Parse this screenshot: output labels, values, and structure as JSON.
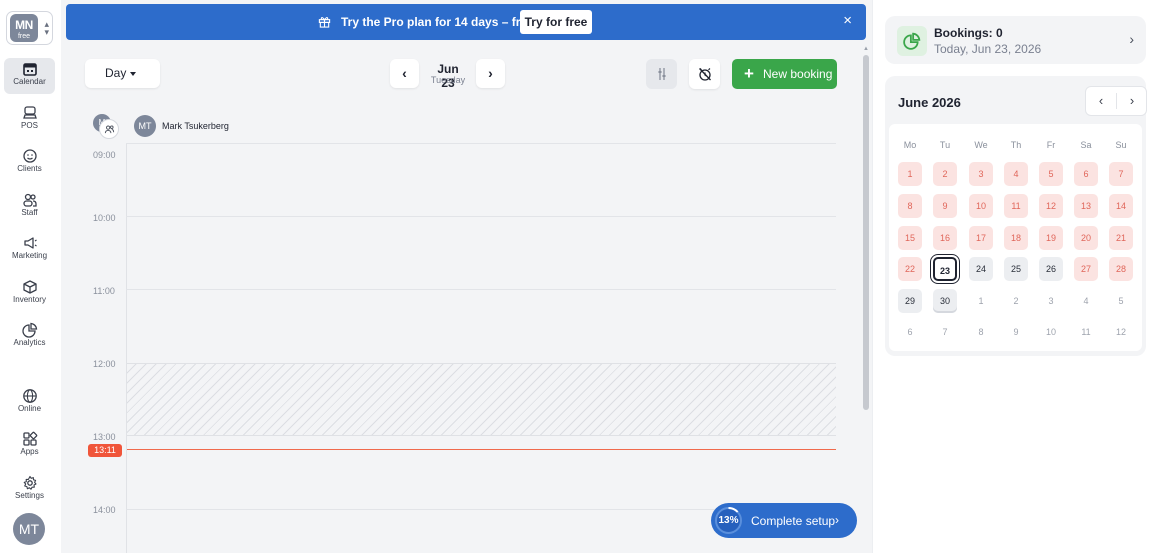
{
  "workspace": {
    "initials": "MN",
    "plan": "free"
  },
  "nav": {
    "items": [
      {
        "label": "Calendar",
        "icon": "calendar-icon"
      },
      {
        "label": "POS",
        "icon": "pos-icon"
      },
      {
        "label": "Clients",
        "icon": "smiley-icon"
      },
      {
        "label": "Staff",
        "icon": "staff-icon"
      },
      {
        "label": "Marketing",
        "icon": "megaphone-icon"
      },
      {
        "label": "Inventory",
        "icon": "box-icon"
      },
      {
        "label": "Analytics",
        "icon": "pie-chart-icon"
      },
      {
        "label": "Online",
        "icon": "globe-icon"
      },
      {
        "label": "Apps",
        "icon": "apps-icon"
      },
      {
        "label": "Settings",
        "icon": "gear-icon"
      }
    ],
    "user_initials": "MT"
  },
  "promo": {
    "text": "Try the Pro plan for 14 days – free!",
    "button": "Try for free",
    "close": "×"
  },
  "toolbar": {
    "view": "Day",
    "date": "Jun 23",
    "weekday": "Tuesday",
    "prev": "‹",
    "next": "›",
    "new_booking_plus": "+",
    "new_booking": "New booking"
  },
  "staff": {
    "group_initials": "M",
    "initials": "MT",
    "name": "Mark Tsukerberg"
  },
  "schedule": {
    "hours": [
      "09:00",
      "10:00",
      "11:00",
      "12:00",
      "13:00",
      "14:00"
    ],
    "blocked_hours": [
      "12:00",
      "13:00"
    ],
    "now": "13:11"
  },
  "setup": {
    "percent": "13%",
    "progress": 0.13,
    "label": "Complete setup",
    "chev": "›"
  },
  "summary": {
    "title": "Bookings: 0",
    "subtitle": "Today, Jun 23, 2026",
    "chev": "›"
  },
  "mini_calendar": {
    "title": "June 2026",
    "prev": "‹",
    "next": "›",
    "weekdays": [
      "Mo",
      "Tu",
      "We",
      "Th",
      "Fr",
      "Sa",
      "Su"
    ],
    "weeks": [
      [
        [
          "1",
          "closed"
        ],
        [
          "2",
          "closed"
        ],
        [
          "3",
          "closed"
        ],
        [
          "4",
          "closed"
        ],
        [
          "5",
          "closed"
        ],
        [
          "6",
          "closed"
        ],
        [
          "7",
          "closed"
        ]
      ],
      [
        [
          "8",
          "closed"
        ],
        [
          "9",
          "closed"
        ],
        [
          "10",
          "closed"
        ],
        [
          "11",
          "closed"
        ],
        [
          "12",
          "closed"
        ],
        [
          "13",
          "closed"
        ],
        [
          "14",
          "closed"
        ]
      ],
      [
        [
          "15",
          "closed"
        ],
        [
          "16",
          "closed"
        ],
        [
          "17",
          "closed"
        ],
        [
          "18",
          "closed"
        ],
        [
          "19",
          "closed"
        ],
        [
          "20",
          "closed"
        ],
        [
          "21",
          "closed"
        ]
      ],
      [
        [
          "22",
          "closed"
        ],
        [
          "23",
          "today"
        ],
        [
          "24",
          "open"
        ],
        [
          "25",
          "open"
        ],
        [
          "26",
          "open"
        ],
        [
          "27",
          "closed"
        ],
        [
          "28",
          "closed"
        ]
      ],
      [
        [
          "29",
          "open"
        ],
        [
          "30",
          "selected"
        ],
        [
          "1",
          "future"
        ],
        [
          "2",
          "future"
        ],
        [
          "3",
          "future"
        ],
        [
          "4",
          "future"
        ],
        [
          "5",
          "future"
        ]
      ],
      [
        [
          "6",
          "future"
        ],
        [
          "7",
          "future"
        ],
        [
          "8",
          "future"
        ],
        [
          "9",
          "future"
        ],
        [
          "10",
          "future"
        ],
        [
          "11",
          "future"
        ],
        [
          "12",
          "future"
        ]
      ]
    ]
  },
  "colors": {
    "promo_bg": "#2d6ccb",
    "new_booking_bg": "#3aa64a",
    "now_line": "#f06a4c",
    "closed_day_bg": "#fbe3e1",
    "closed_day_text": "#e0665a"
  }
}
